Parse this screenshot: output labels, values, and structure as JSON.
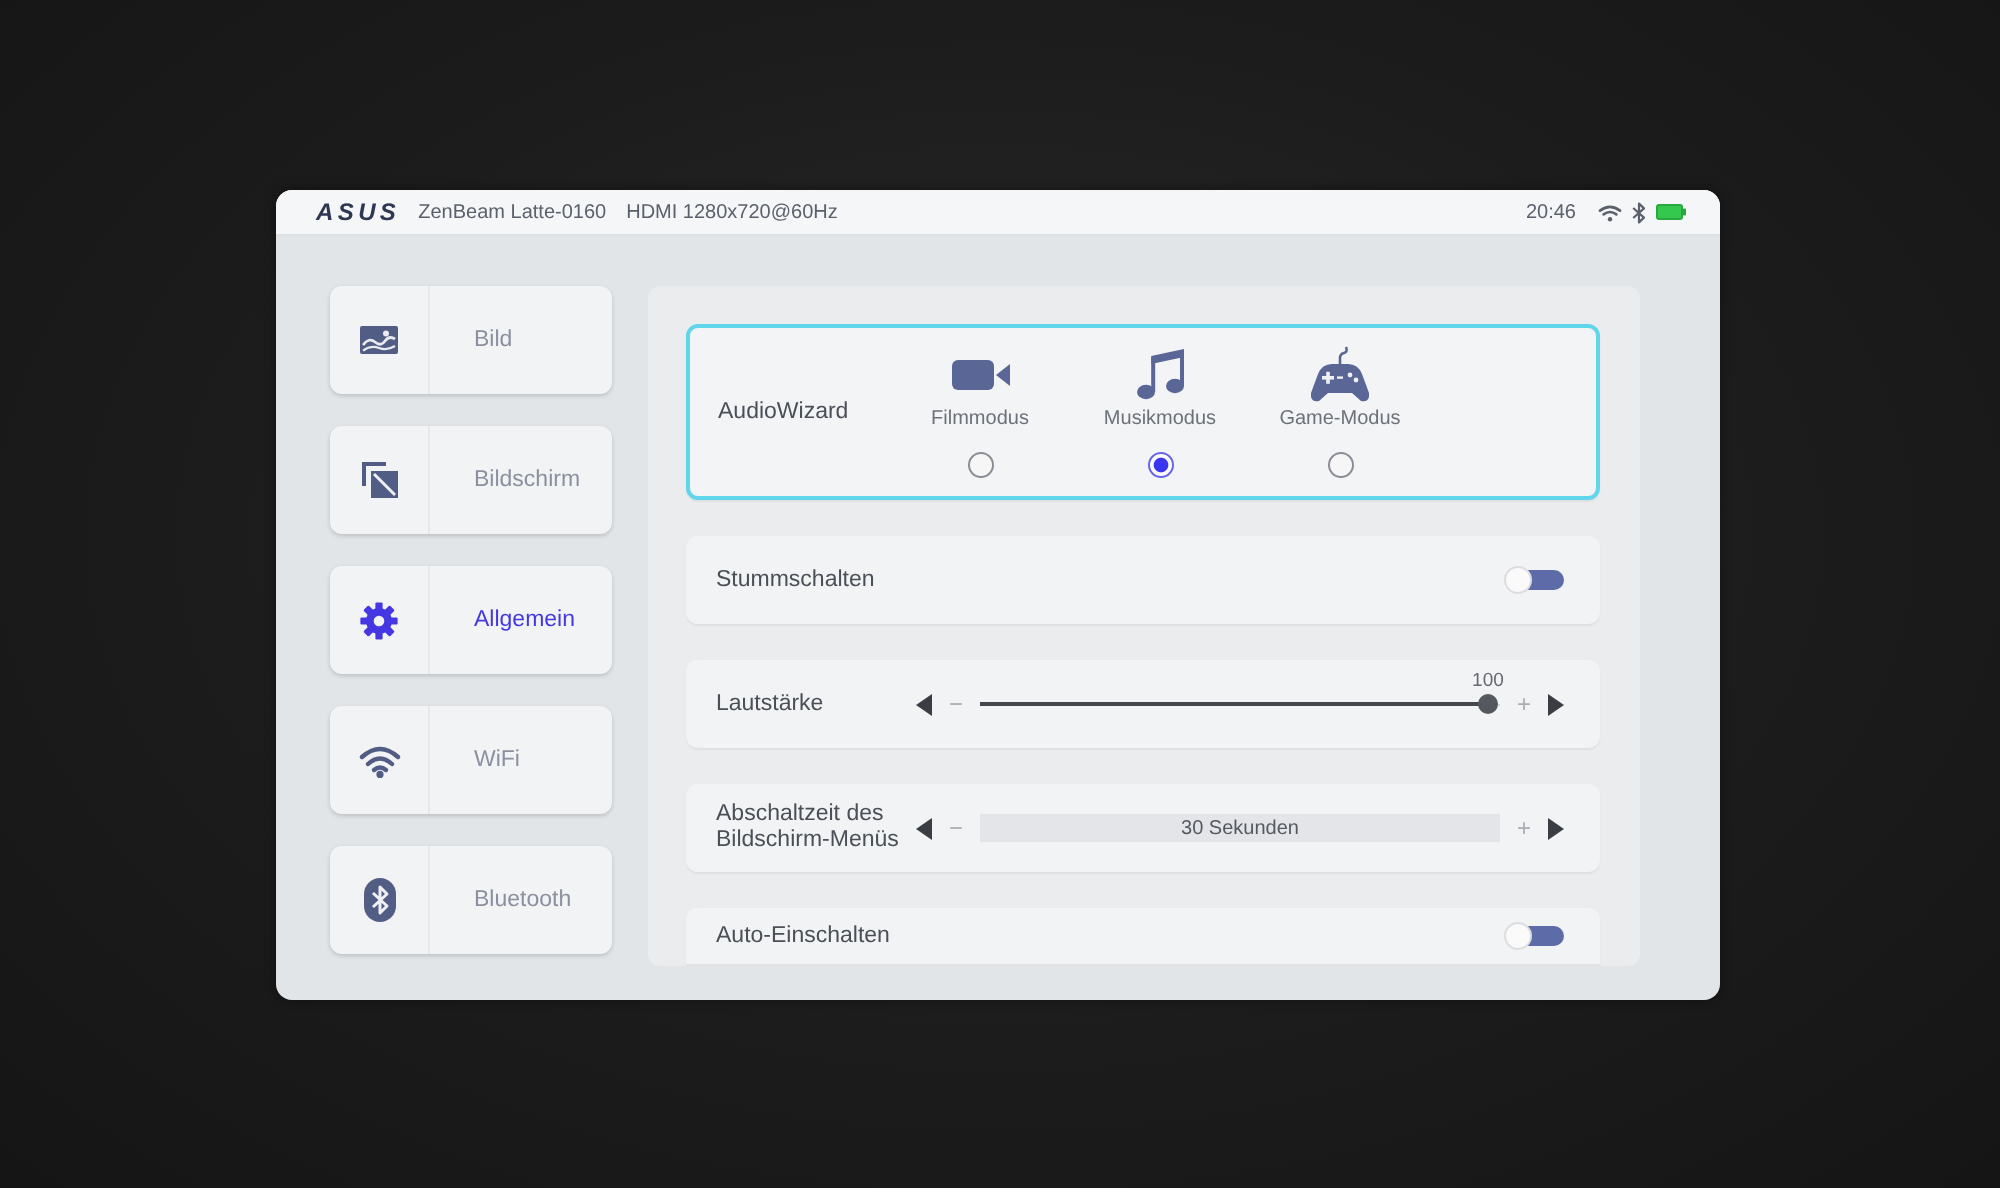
{
  "status_bar": {
    "brand": "ASUS",
    "device": "ZenBeam Latte-0160",
    "input": "HDMI 1280x720@60Hz",
    "time": "20:46"
  },
  "sidebar": {
    "items": [
      {
        "label": "Bild",
        "selected": false
      },
      {
        "label": "Bildschirm",
        "selected": false
      },
      {
        "label": "Allgemein",
        "selected": true
      },
      {
        "label": "WiFi",
        "selected": false
      },
      {
        "label": "Bluetooth",
        "selected": false
      }
    ]
  },
  "settings": [
    {
      "kind": "audio_wizard",
      "label": "AudioWizard",
      "focused": true,
      "options": [
        {
          "label": "Filmmodus",
          "selected": false
        },
        {
          "label": "Musikmodus",
          "selected": true
        },
        {
          "label": "Game-Modus",
          "selected": false
        }
      ]
    },
    {
      "kind": "toggle",
      "label": "Stummschalten",
      "on": false
    },
    {
      "kind": "slider",
      "label": "Lautstärke",
      "decrease": "−",
      "increase": "+",
      "reading": "100",
      "level": 1
    },
    {
      "kind": "stepper",
      "label": "Abschaltzeit des Bildschirm-Menüs",
      "decrease": "−",
      "increase": "+",
      "value": "30 Sekunden"
    },
    {
      "kind": "toggle",
      "label": "Auto-Einschalten",
      "on": false
    }
  ]
}
